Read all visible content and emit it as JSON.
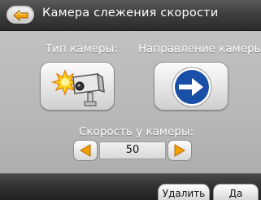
{
  "header": {
    "title": "Камера слежения скорости",
    "back_icon": "back-arrow-icon"
  },
  "camera_type": {
    "label": "Тип камеры:",
    "icon": "speed-camera-icon"
  },
  "camera_direction": {
    "label": "Направление камеры:",
    "icon": "arrow-right-icon"
  },
  "speed": {
    "label": "Скорость у камеры:",
    "value": "50"
  },
  "footer": {
    "delete_label": "Удалить",
    "ok_label": "Да"
  },
  "colors": {
    "accent_orange": "#f5a000",
    "direction_blue": "#1a4fa8"
  }
}
